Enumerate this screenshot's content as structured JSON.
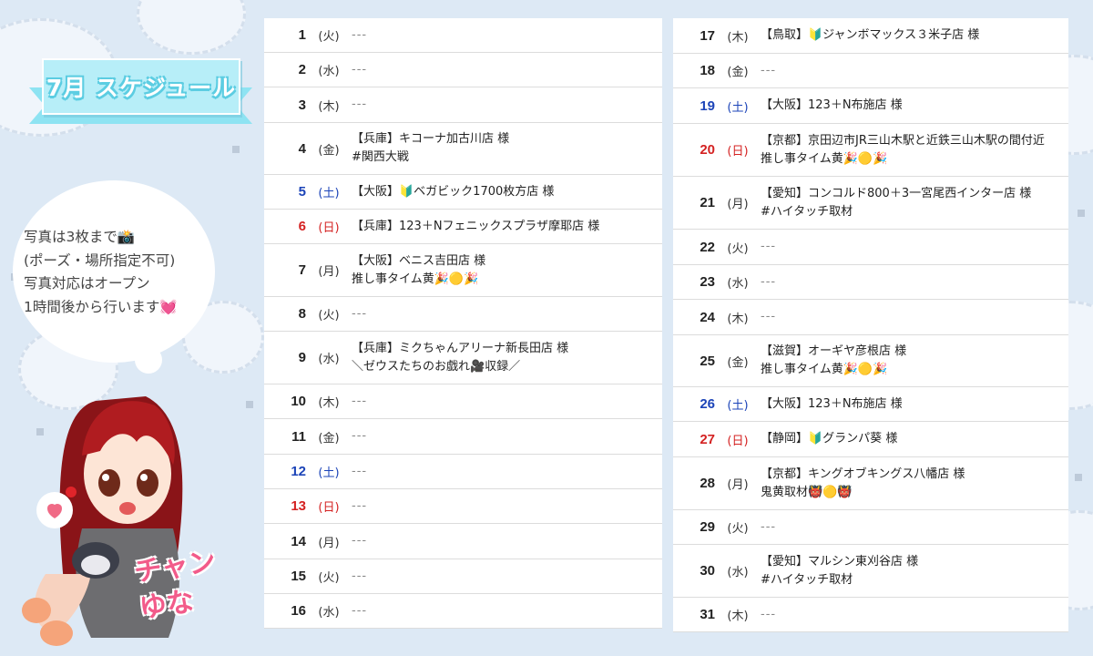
{
  "banner": {
    "title": "7月 スケジュール"
  },
  "note": {
    "lines": [
      "写真は3枚まで📸",
      "(ポーズ・場所指定不可)",
      "写真対応はオープン",
      "1時間後から行います💓"
    ]
  },
  "character": {
    "signature": "チャン ゆな"
  },
  "schedule": {
    "left": [
      {
        "day": "1",
        "wk": "(火)",
        "lines": [
          "---"
        ]
      },
      {
        "day": "2",
        "wk": "(水)",
        "lines": [
          "---"
        ]
      },
      {
        "day": "3",
        "wk": "(木)",
        "lines": [
          "---"
        ]
      },
      {
        "day": "4",
        "wk": "(金)",
        "lines": [
          "【兵庫】キコーナ加古川店 様",
          "#関西大戦"
        ]
      },
      {
        "day": "5",
        "wk": "(土)",
        "lines": [
          "【大阪】🔰ベガビック1700枚方店 様"
        ]
      },
      {
        "day": "6",
        "wk": "(日)",
        "lines": [
          "【兵庫】123＋Nフェニックスプラザ摩耶店 様"
        ]
      },
      {
        "day": "7",
        "wk": "(月)",
        "lines": [
          "【大阪】ベニス吉田店 様",
          "推し事タイム黄🎉🟡🎉"
        ]
      },
      {
        "day": "8",
        "wk": "(火)",
        "lines": [
          "---"
        ]
      },
      {
        "day": "9",
        "wk": "(水)",
        "lines": [
          "【兵庫】ミクちゃんアリーナ新長田店 様",
          "＼ゼウスたちのお戯れ🎥収録／"
        ]
      },
      {
        "day": "10",
        "wk": "(木)",
        "lines": [
          "---"
        ]
      },
      {
        "day": "11",
        "wk": "(金)",
        "lines": [
          "---"
        ]
      },
      {
        "day": "12",
        "wk": "(土)",
        "lines": [
          "---"
        ]
      },
      {
        "day": "13",
        "wk": "(日)",
        "lines": [
          "---"
        ]
      },
      {
        "day": "14",
        "wk": "(月)",
        "lines": [
          "---"
        ]
      },
      {
        "day": "15",
        "wk": "(火)",
        "lines": [
          "---"
        ]
      },
      {
        "day": "16",
        "wk": "(水)",
        "lines": [
          "---"
        ]
      }
    ],
    "right": [
      {
        "day": "17",
        "wk": "(木)",
        "lines": [
          "【鳥取】🔰ジャンボマックス３米子店 様"
        ]
      },
      {
        "day": "18",
        "wk": "(金)",
        "lines": [
          "---"
        ]
      },
      {
        "day": "19",
        "wk": "(土)",
        "lines": [
          "【大阪】123＋N布施店 様"
        ]
      },
      {
        "day": "20",
        "wk": "(日)",
        "lines": [
          "【京都】京田辺市JR三山木駅と近鉄三山木駅の間付近",
          "推し事タイム黄🎉🟡🎉"
        ]
      },
      {
        "day": "21",
        "wk": "(月)",
        "lines": [
          "【愛知】コンコルド800＋3一宮尾西インター店 様",
          "#ハイタッチ取材"
        ]
      },
      {
        "day": "22",
        "wk": "(火)",
        "lines": [
          "---"
        ]
      },
      {
        "day": "23",
        "wk": "(水)",
        "lines": [
          "---"
        ]
      },
      {
        "day": "24",
        "wk": "(木)",
        "lines": [
          "---"
        ]
      },
      {
        "day": "25",
        "wk": "(金)",
        "lines": [
          "【滋賀】オーギヤ彦根店 様",
          "推し事タイム黄🎉🟡🎉"
        ]
      },
      {
        "day": "26",
        "wk": "(土)",
        "lines": [
          "【大阪】123＋N布施店 様"
        ]
      },
      {
        "day": "27",
        "wk": "(日)",
        "lines": [
          "【静岡】🔰グランパ葵 様"
        ]
      },
      {
        "day": "28",
        "wk": "(月)",
        "lines": [
          "【京都】キングオブキングス八幡店 様",
          "鬼黄取材👹🟡👹"
        ]
      },
      {
        "day": "29",
        "wk": "(火)",
        "lines": [
          "---"
        ]
      },
      {
        "day": "30",
        "wk": "(水)",
        "lines": [
          "【愛知】マルシン東刈谷店 様",
          "#ハイタッチ取材"
        ]
      },
      {
        "day": "31",
        "wk": "(木)",
        "lines": [
          "---"
        ]
      }
    ]
  },
  "colors": {
    "background": "#dde9f5",
    "banner": "#b7eef8",
    "saturday": "#1c44b8",
    "sunday": "#d42222"
  }
}
